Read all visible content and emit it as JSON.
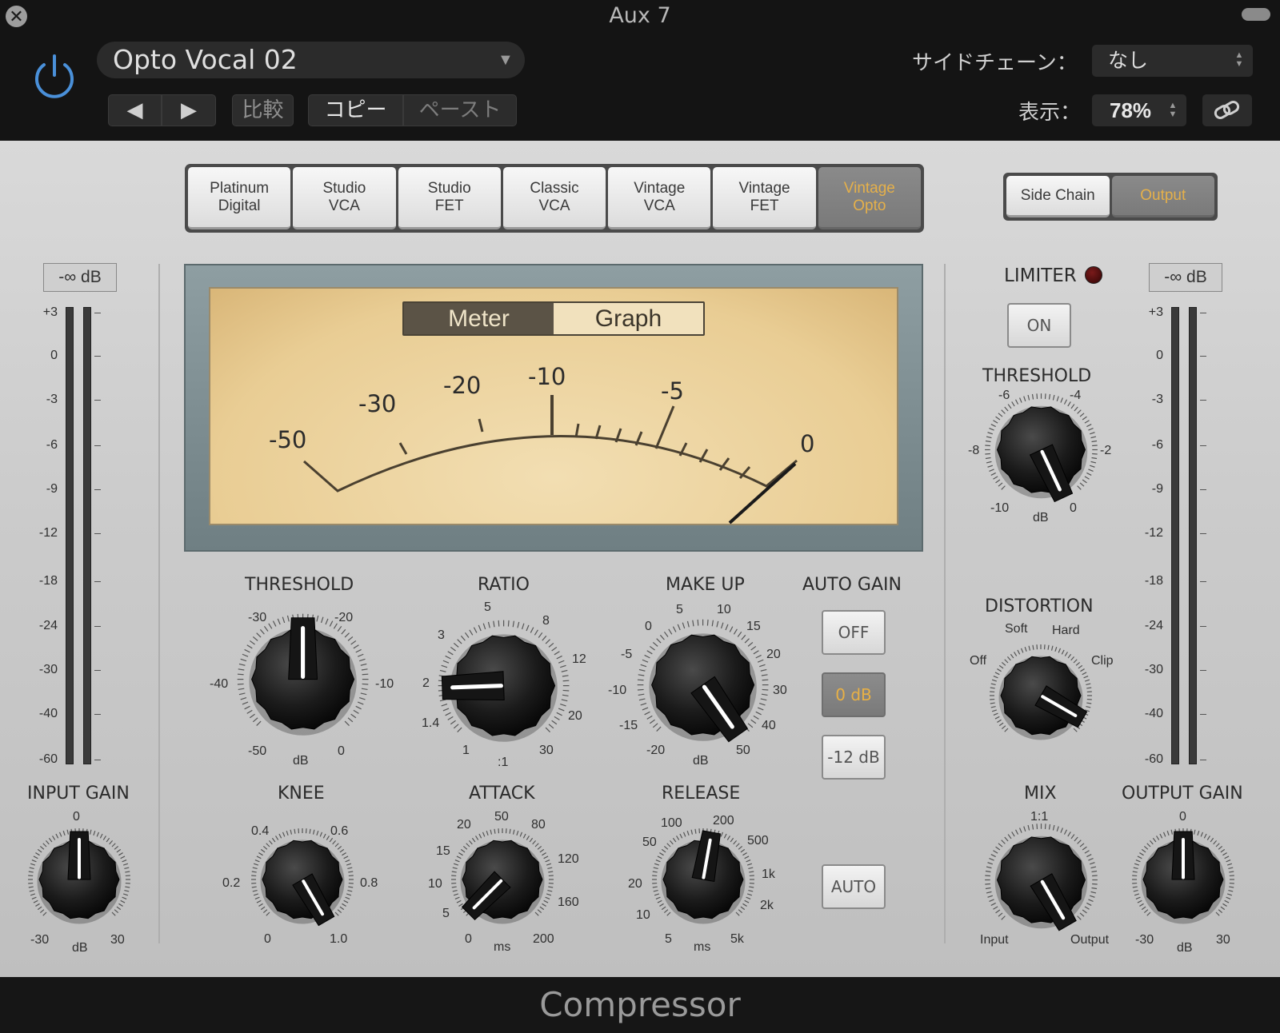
{
  "window": {
    "title": "Aux 7"
  },
  "header": {
    "preset": "Opto Vocal 02",
    "prev_glyph": "◀",
    "next_glyph": "▶",
    "compare": "比較",
    "copy": "コピー",
    "paste": "ペースト",
    "sidechain_label": "サイドチェーン：",
    "sidechain_value": "なし",
    "view_label": "表示：",
    "zoom": "78%"
  },
  "models": {
    "tabs": [
      "Platinum\nDigital",
      "Studio\nVCA",
      "Studio\nFET",
      "Classic\nVCA",
      "Vintage\nVCA",
      "Vintage\nFET",
      "Vintage\nOpto"
    ],
    "selected": "Vintage\nOpto"
  },
  "view_tabs": {
    "side_chain": "Side Chain",
    "output": "Output",
    "selected": "output"
  },
  "meter": {
    "mode_meter": "Meter",
    "mode_graph": "Graph",
    "mode_selected": "meter",
    "scale": [
      "-50",
      "-30",
      "-20",
      "-10",
      "-5",
      "0"
    ],
    "needle_value": "0"
  },
  "input_meter": {
    "readout": "-∞ dB",
    "scale": [
      "+3",
      "0",
      "-3",
      "-6",
      "-9",
      "-12",
      "-18",
      "-24",
      "-30",
      "-40",
      "-60"
    ]
  },
  "output_meter": {
    "readout": "-∞ dB",
    "scale": [
      "+3",
      "0",
      "-3",
      "-6",
      "-9",
      "-12",
      "-18",
      "-24",
      "-30",
      "-40",
      "-60"
    ]
  },
  "knobs": {
    "input_gain": {
      "title": "INPUT GAIN",
      "top": "0",
      "min": "-30",
      "max": "30",
      "unit": "dB"
    },
    "threshold": {
      "title": "THRESHOLD",
      "s1": "-30",
      "s2": "-20",
      "s3": "-40",
      "s4": "-10",
      "s5": "-50",
      "s6": "0",
      "unit": "dB"
    },
    "ratio": {
      "title": "RATIO",
      "s1": "5",
      "s2": "8",
      "s3": "3",
      "s4": "12",
      "s5": "2",
      "s6": "20",
      "s7": "1.4",
      "s8": "1",
      "s9": "30",
      "unit": ":1"
    },
    "makeup": {
      "title": "MAKE UP",
      "s1": "5",
      "s2": "10",
      "s3": "0",
      "s4": "15",
      "s5": "-5",
      "s6": "20",
      "s7": "-10",
      "s8": "30",
      "s9": "-15",
      "s10": "40",
      "s11": "-20",
      "s12": "50",
      "unit": "dB"
    },
    "knee": {
      "title": "KNEE",
      "s1": "0.4",
      "s2": "0.6",
      "s3": "0.2",
      "s4": "0.8",
      "s5": "0",
      "s6": "1.0"
    },
    "attack": {
      "title": "ATTACK",
      "s1": "50",
      "s2": "20",
      "s3": "80",
      "s4": "15",
      "s5": "120",
      "s6": "10",
      "s7": "160",
      "s8": "5",
      "s9": "0",
      "s10": "200",
      "unit": "ms"
    },
    "release": {
      "title": "RELEASE",
      "s1": "100",
      "s2": "200",
      "s3": "50",
      "s4": "500",
      "s5": "20",
      "s6": "1k",
      "s7": "2k",
      "s8": "10",
      "s9": "5",
      "s10": "5k",
      "unit": "ms"
    },
    "limiter_threshold": {
      "title": "THRESHOLD",
      "s1": "-6",
      "s2": "-4",
      "s3": "-8",
      "s4": "-2",
      "s5": "-10",
      "s6": "0",
      "unit": "dB"
    },
    "distortion": {
      "title": "DISTORTION",
      "s1": "Soft",
      "s2": "Hard",
      "s3": "Off",
      "s4": "Clip"
    },
    "mix": {
      "title": "MIX",
      "top": "1:1",
      "min": "Input",
      "max": "Output"
    },
    "output_gain": {
      "title": "OUTPUT GAIN",
      "top": "0",
      "min": "-30",
      "max": "30",
      "unit": "dB"
    }
  },
  "auto_gain": {
    "title": "AUTO GAIN",
    "off": "OFF",
    "zero": "0 dB",
    "minus12": "-12 dB",
    "selected": "0 dB"
  },
  "auto_release": {
    "label": "AUTO"
  },
  "limiter": {
    "title": "LIMITER",
    "on": "ON"
  },
  "footer": {
    "title": "Compressor"
  },
  "colors": {
    "accent": "#e8b045",
    "power": "#4a90d9",
    "meter_face": "#ecd29a"
  }
}
